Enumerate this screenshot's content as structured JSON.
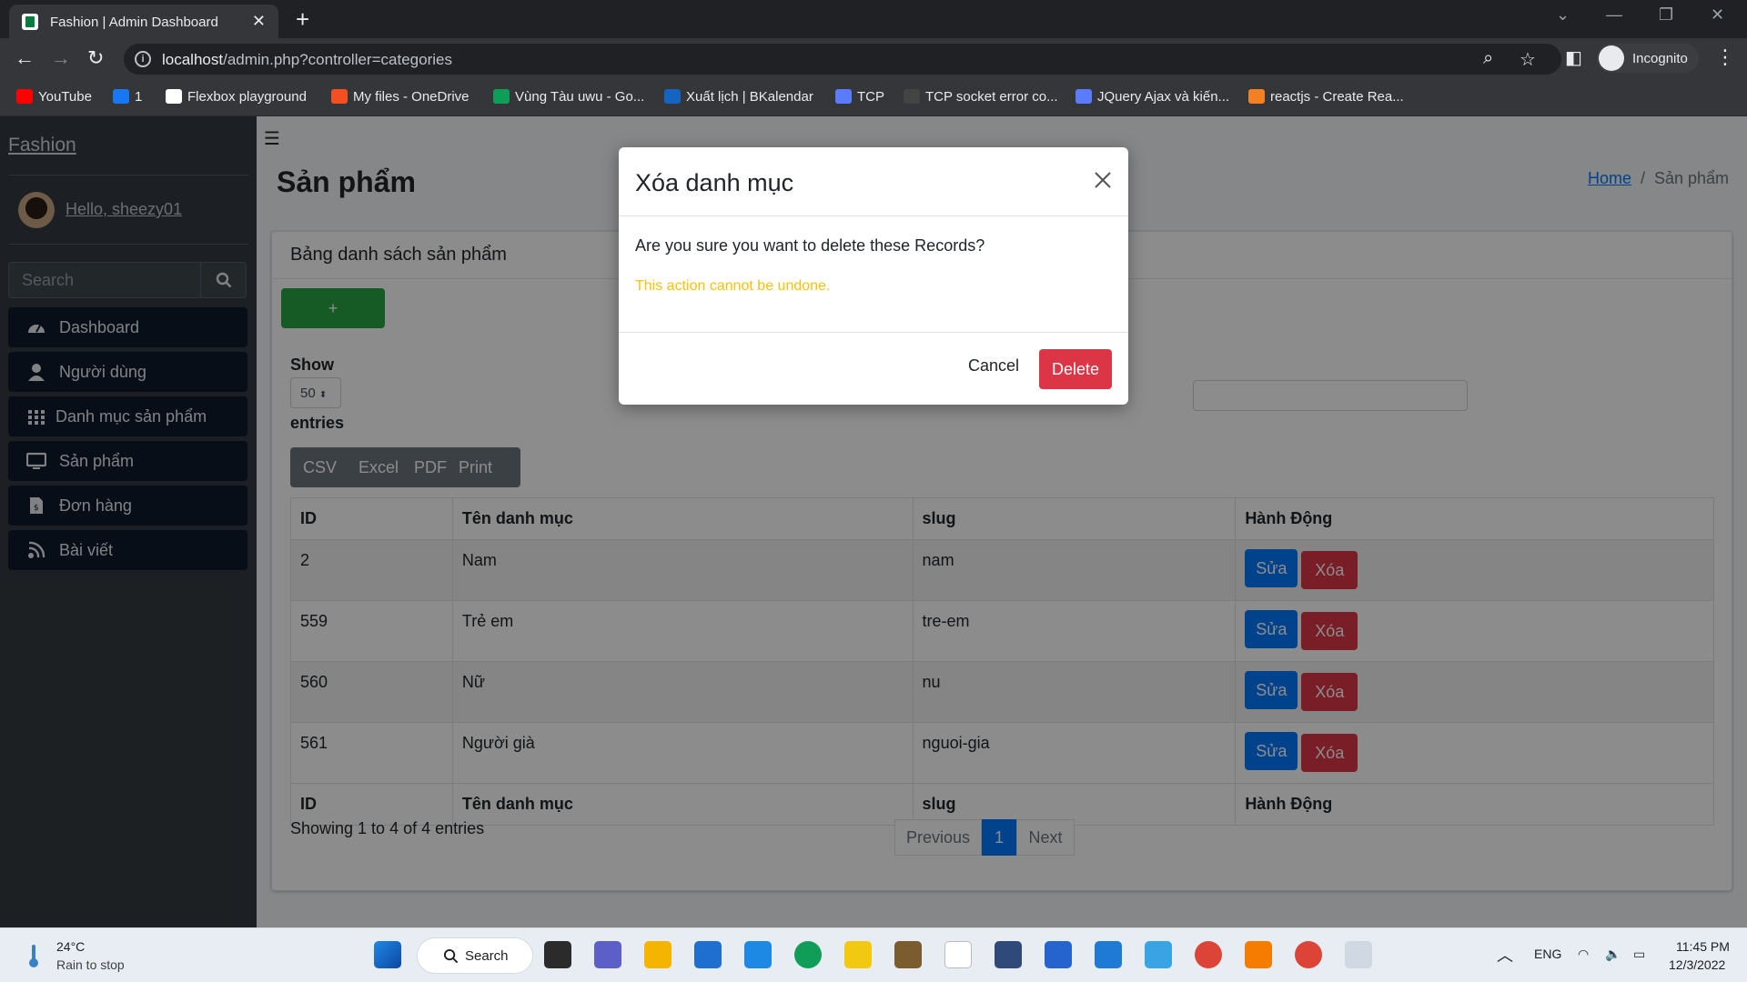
{
  "browser": {
    "tab_title": "Fashion | Admin Dashboard",
    "url_host": "localhost",
    "url_path": "/admin.php?controller=categories",
    "profile_label": "Incognito",
    "bookmarks": [
      {
        "label": "YouTube",
        "color": "#ff0000"
      },
      {
        "label": "1",
        "color": "#1877f2"
      },
      {
        "label": "Flexbox playground",
        "color": "#ffffff"
      },
      {
        "label": "My files - OneDrive",
        "color": "#f25022"
      },
      {
        "label": "Vùng Tàu uwu - Go...",
        "color": "#0f9d58"
      },
      {
        "label": "Xuất lịch | BKalendar",
        "color": "#1565c0"
      },
      {
        "label": "TCP",
        "color": "#5b7cfa"
      },
      {
        "label": "TCP socket error co...",
        "color": "#444444"
      },
      {
        "label": "JQuery Ajax và kiến...",
        "color": "#5b7cfa"
      },
      {
        "label": "reactjs - Create Rea...",
        "color": "#f48024"
      }
    ]
  },
  "sidebar": {
    "brand": "Fashion",
    "user_greeting": "Hello, sheezy01",
    "search_placeholder": "Search",
    "menu": [
      {
        "label": "Dashboard",
        "icon": "dashboard-icon"
      },
      {
        "label": "Người dùng",
        "icon": "user-icon"
      },
      {
        "label": "Danh mục sản phẩm",
        "icon": "grid-icon"
      },
      {
        "label": "Sản phẩm",
        "icon": "desktop-icon"
      },
      {
        "label": "Đơn hàng",
        "icon": "invoice-icon"
      },
      {
        "label": "Bài viết",
        "icon": "blog-icon"
      }
    ]
  },
  "header": {
    "title": "Sản phẩm",
    "breadcrumb_home": "Home",
    "breadcrumb_sep": "/",
    "breadcrumb_current": "Sản phẩm"
  },
  "card": {
    "title": "Bảng danh sách sản phẩm",
    "add_label": "+",
    "show_label": "Show",
    "page_size": "50",
    "entries_label": "entries",
    "export_buttons": [
      "CSV",
      "Excel",
      "PDF",
      "Print"
    ],
    "columns": [
      "ID",
      "Tên danh mục",
      "slug",
      "Hành Động"
    ],
    "rows": [
      {
        "id": "2",
        "name": "Nam",
        "slug": "nam"
      },
      {
        "id": "559",
        "name": "Trẻ em",
        "slug": "tre-em"
      },
      {
        "id": "560",
        "name": "Nữ",
        "slug": "nu"
      },
      {
        "id": "561",
        "name": "Người già",
        "slug": "nguoi-gia"
      }
    ],
    "edit_label": "Sửa",
    "delete_label": "Xóa",
    "info": "Showing 1 to 4 of 4 entries",
    "pagination": {
      "previous": "Previous",
      "current": "1",
      "next": "Next"
    }
  },
  "modal": {
    "title": "Xóa danh mục",
    "message": "Are you sure you want to delete these Records?",
    "warning": "This action cannot be undone.",
    "cancel_label": "Cancel",
    "delete_label": "Delete"
  },
  "taskbar": {
    "temperature": "24°C",
    "weather": "Rain to stop",
    "search_label": "Search",
    "language": "ENG",
    "time": "11:45 PM",
    "date": "12/3/2022"
  },
  "colors": {
    "primary": "#007bff",
    "danger": "#dc3545",
    "success": "#28a745",
    "warning": "#ffc107",
    "sidebar_bg": "#343a40"
  }
}
